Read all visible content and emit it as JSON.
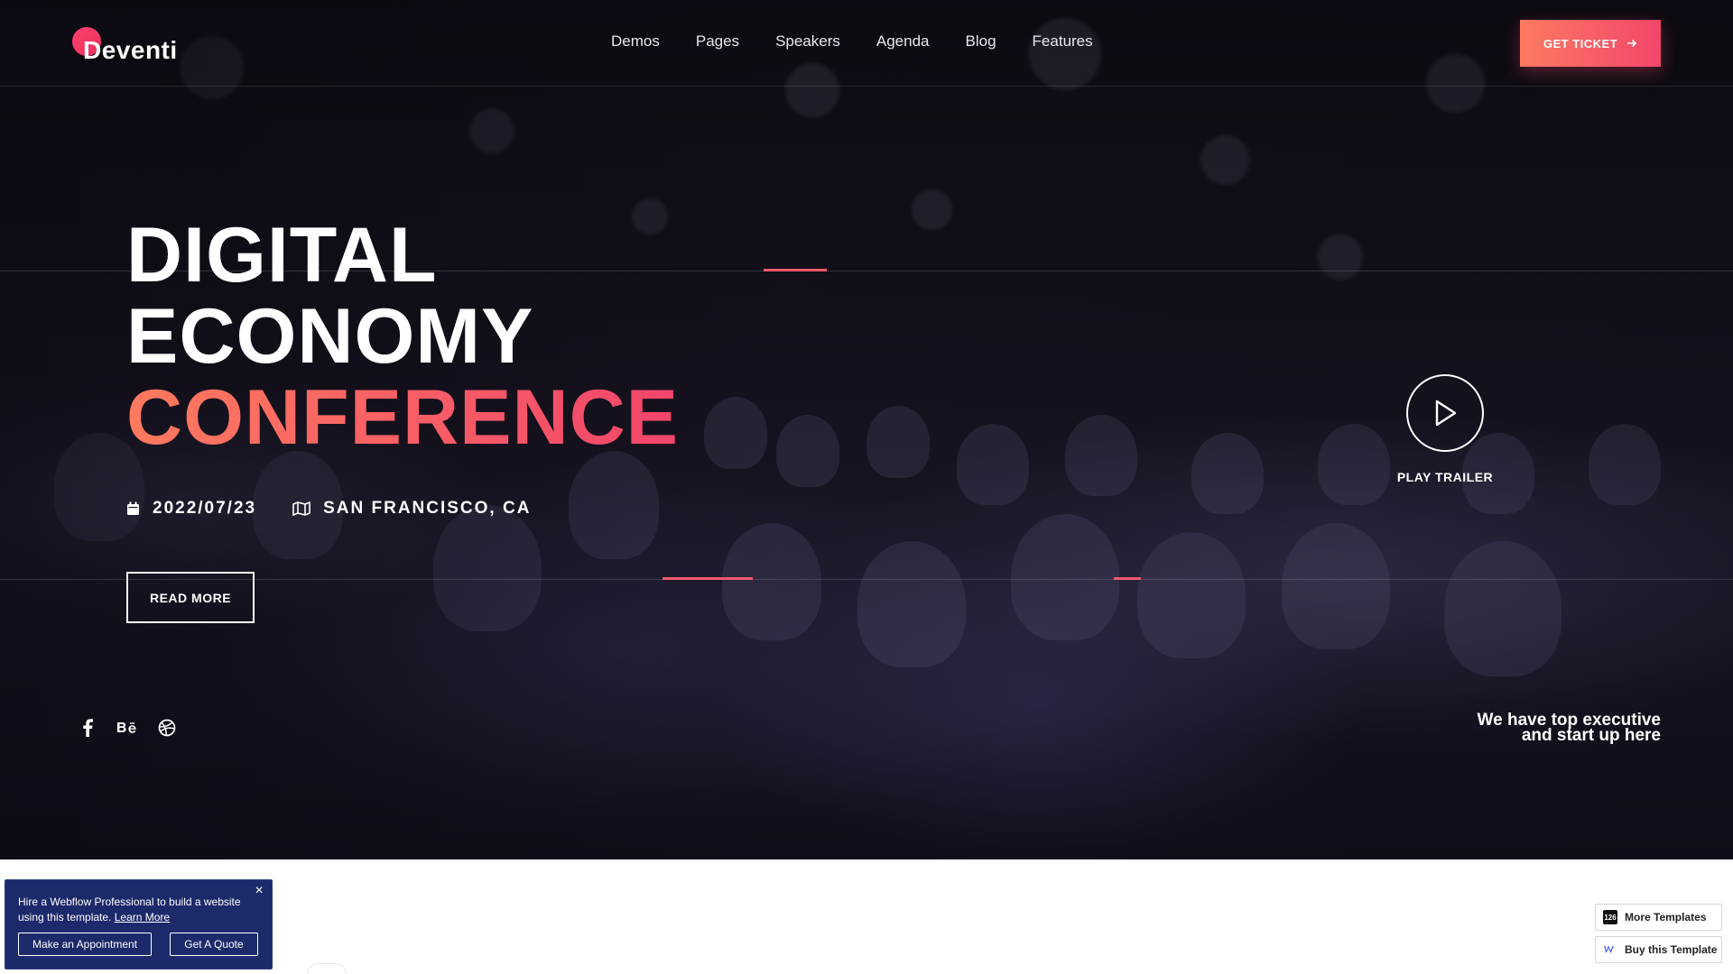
{
  "nav": {
    "logo": "Deventi",
    "menu": [
      "Demos",
      "Pages",
      "Speakers",
      "Agenda",
      "Blog",
      "Features"
    ],
    "ticket_label": "GET TICKET"
  },
  "hero": {
    "title_line1": "DIGITAL",
    "title_line2": "ECONOMY",
    "title_line3": "CONFERENCE",
    "date": "2022/07/23",
    "location": "SAN FRANCISCO, CA",
    "read_more": "READ MORE",
    "play_label": "PLAY TRAILER",
    "tagline_line1": "We have top executive",
    "tagline_line2": "and start up here",
    "social": [
      "facebook-icon",
      "behance-icon",
      "dribbble-icon"
    ]
  },
  "promo": {
    "text": "Hire a Webflow Professional to build a website using this template.",
    "link": "Learn More",
    "btn_appointment": "Make an Appointment",
    "btn_quote": "Get A Quote"
  },
  "templates": {
    "more": "More Templates",
    "more_badge": "126",
    "buy": "Buy this Template"
  },
  "colors": {
    "accent_start": "#ff7a5e",
    "accent_end": "#f2456c",
    "promo_bg": "#1c2a6b"
  }
}
